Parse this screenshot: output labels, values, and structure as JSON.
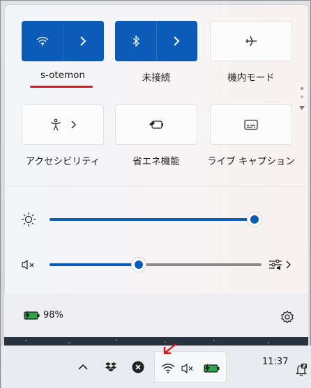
{
  "quick_settings": {
    "tiles_row1": [
      {
        "id": "wifi",
        "label": "s-otemon",
        "state": "on",
        "icon": "wifi-icon"
      },
      {
        "id": "bluetooth",
        "label": "未接続",
        "state": "on",
        "icon": "bluetooth-icon"
      },
      {
        "id": "airplane",
        "label": "機内モード",
        "state": "off",
        "icon": "airplane-icon"
      }
    ],
    "tiles_row2": [
      {
        "id": "accessibility",
        "label": "アクセシビリティ",
        "icon": "accessibility-icon"
      },
      {
        "id": "energy_saver",
        "label": "省エネ機能",
        "icon": "energy-saver-icon"
      },
      {
        "id": "live_captions",
        "label": "ライブ キャプション",
        "icon": "captions-icon"
      }
    ],
    "brightness": {
      "icon": "brightness-sun-icon",
      "level": 1.0
    },
    "volume": {
      "icon": "volume-muted-icon",
      "level": 0.42,
      "muted": true
    },
    "battery": {
      "icon": "battery-charging-icon",
      "percent_text": "98%"
    },
    "settings_icon": "gear-icon"
  },
  "taskbar": {
    "time": "11:37",
    "tray_icons": [
      "chevron-up-icon",
      "dropbox-icon",
      "close-circle-icon"
    ],
    "system_icons": [
      "wifi-icon",
      "volume-muted-icon",
      "battery-charging-icon"
    ],
    "notification_icon": "bell-icon"
  },
  "colors": {
    "accent": "#0b5cb8",
    "annotation": "#e0151a"
  }
}
